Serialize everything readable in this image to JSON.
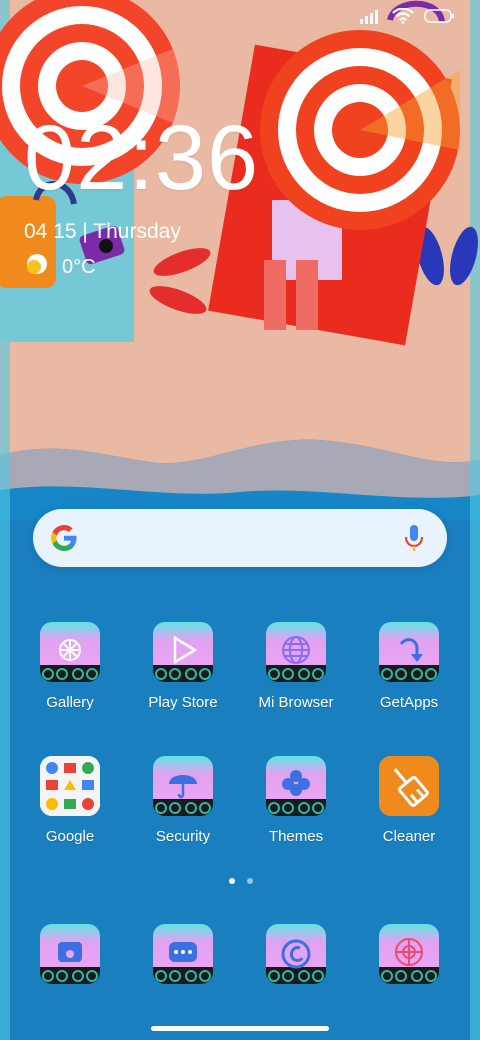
{
  "status_bar": {
    "icons": [
      "signal-icon",
      "wifi-icon",
      "battery-icon"
    ]
  },
  "lockscreen": {
    "time": "02:36",
    "date": "04 15 | Thursday",
    "temperature": "0°C"
  },
  "search": {
    "icons": [
      "google-logo",
      "microphone-icon"
    ]
  },
  "apps_row1": [
    {
      "label": "Gallery",
      "icon": "flower-icon"
    },
    {
      "label": "Play Store",
      "icon": "play-icon"
    },
    {
      "label": "Mi Browser",
      "icon": "globe-icon"
    },
    {
      "label": "GetApps",
      "icon": "download-icon"
    }
  ],
  "apps_row2": [
    {
      "label": "Google",
      "icon": "google-folder-icon"
    },
    {
      "label": "Security",
      "icon": "umbrella-icon"
    },
    {
      "label": "Themes",
      "icon": "clover-icon"
    },
    {
      "label": "Cleaner",
      "icon": "broom-icon"
    }
  ],
  "dock": [
    {
      "icon": "phone-icon"
    },
    {
      "icon": "message-icon"
    },
    {
      "icon": "camera-icon"
    },
    {
      "icon": "aperture-icon"
    }
  ],
  "page_indicator": {
    "pages": 2,
    "current": 1
  },
  "colors": {
    "sand": "#eab9a3",
    "sea": "#1a7fbf",
    "umbrella_red": "#f0421e",
    "towel_red": "#ea2c1e",
    "towel_blue": "#76c8d6",
    "cleaner_orange": "#f08a1c"
  }
}
